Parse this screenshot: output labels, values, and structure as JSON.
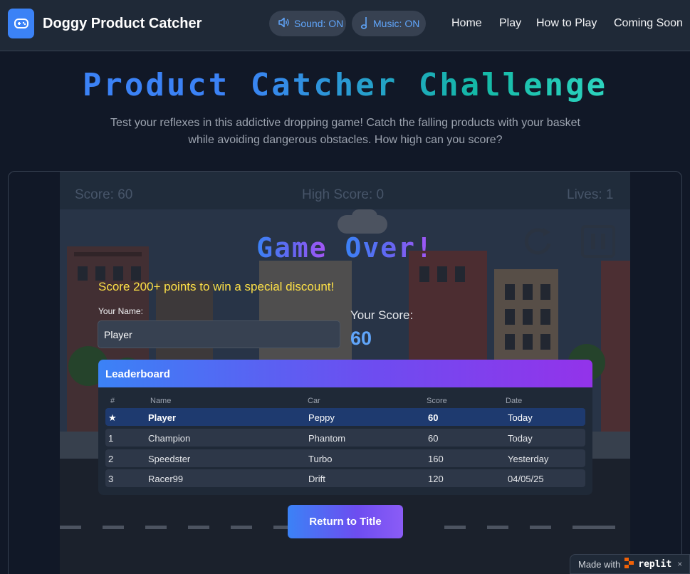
{
  "header": {
    "app_title": "Doggy Product Catcher",
    "sound_label": "Sound: ON",
    "music_label": "Music: ON",
    "nav": [
      {
        "label": "Home"
      },
      {
        "label": "Play"
      },
      {
        "label": "How to Play"
      },
      {
        "label": "Coming Soon"
      }
    ]
  },
  "hero": {
    "title": "Product Catcher Challenge",
    "subtitle": "Test your reflexes in this addictive dropping game! Catch the falling products with your basket while avoiding dangerous obstacles. How high can you score?"
  },
  "game": {
    "hud": {
      "score": "Score: 60",
      "high_score": "High Score: 0",
      "lives": "Lives: 1"
    },
    "game_over_word1": "Game",
    "game_over_word2": "Over!",
    "discount_message": "Score 200+ points to win a special discount!",
    "name_label": "Your Name:",
    "name_value": "Player",
    "your_score_label": "Your Score:",
    "your_score_value": "60",
    "return_button": "Return to Title"
  },
  "leaderboard": {
    "title": "Leaderboard",
    "columns": [
      "#",
      "Name",
      "Car",
      "Score",
      "Date"
    ],
    "rows": [
      {
        "rank": "★",
        "name": "Player",
        "car": "Peppy",
        "score": "60",
        "date": "Today"
      },
      {
        "rank": "1",
        "name": "Champion",
        "car": "Phantom",
        "score": "60",
        "date": "Today"
      },
      {
        "rank": "2",
        "name": "Speedster",
        "car": "Turbo",
        "score": "160",
        "date": "Yesterday"
      },
      {
        "rank": "3",
        "name": "Racer99",
        "car": "Drift",
        "score": "120",
        "date": "04/05/25"
      }
    ]
  },
  "badge": {
    "made_with": "Made with",
    "brand": "replit",
    "close": "×"
  },
  "colors": {
    "accent_blue": "#3b82f6",
    "accent_purple": "#9333ea",
    "accent_teal": "#14b8a6",
    "discount_yellow": "#fde047"
  }
}
